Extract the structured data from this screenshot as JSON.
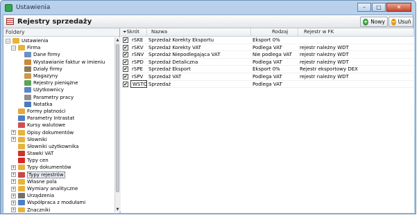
{
  "window": {
    "title": "Ustawienia",
    "buttons": {
      "minimize": "–",
      "maximize": "□",
      "close": "✕"
    }
  },
  "header": {
    "title": "Rejestry sprzedaży",
    "new_label": "Nowy",
    "delete_label": "Usuń"
  },
  "tree": {
    "header": "Foldery",
    "items": [
      {
        "label": "Ustawienia",
        "level": 0,
        "expander": "−",
        "icon": "folder-icon",
        "color": "#e6b33c"
      },
      {
        "label": "Firma",
        "level": 1,
        "expander": "−",
        "icon": "folder-icon",
        "color": "#e6b33c"
      },
      {
        "label": "Dane firmy",
        "level": 2,
        "expander": "",
        "icon": "document-icon",
        "color": "#6c8fc7"
      },
      {
        "label": "Wystawianie faktur w imieniu",
        "level": 2,
        "expander": "",
        "icon": "users-icon",
        "color": "#c98a3d"
      },
      {
        "label": "Działy firmy",
        "level": 2,
        "expander": "",
        "icon": "building-icon",
        "color": "#8d7b5d"
      },
      {
        "label": "Magazyny",
        "level": 2,
        "expander": "",
        "icon": "warehouse-icon",
        "color": "#c99a4f"
      },
      {
        "label": "Rejestry pieniężne",
        "level": 2,
        "expander": "",
        "icon": "money-icon",
        "color": "#5ba35b"
      },
      {
        "label": "Użytkownicy",
        "level": 2,
        "expander": "",
        "icon": "users-icon",
        "color": "#5b86c9"
      },
      {
        "label": "Parametry pracy",
        "level": 2,
        "expander": "",
        "icon": "parameters-icon",
        "color": "#8e8e8e"
      },
      {
        "label": "Notatka",
        "level": 2,
        "expander": "",
        "icon": "note-icon",
        "color": "#4b7bc0"
      },
      {
        "label": "Formy płatności",
        "level": 1,
        "expander": "",
        "icon": "payment-icon",
        "color": "#e5a93a"
      },
      {
        "label": "Parametry Intrastat",
        "level": 1,
        "expander": "",
        "icon": "checkmark-icon",
        "color": "#4f7ec3"
      },
      {
        "label": "Kursy walutowe",
        "level": 1,
        "expander": "",
        "icon": "chart-icon",
        "color": "#d44d4d"
      },
      {
        "label": "Opisy dokumentów",
        "level": 1,
        "expander": "+",
        "icon": "folder-icon",
        "color": "#e6b33c"
      },
      {
        "label": "Słowniki",
        "level": 1,
        "expander": "+",
        "icon": "folder-icon",
        "color": "#e6b33c"
      },
      {
        "label": "Słowniki użytkownika",
        "level": 1,
        "expander": "",
        "icon": "folder-icon",
        "color": "#e6b33c"
      },
      {
        "label": "Stawki VAT",
        "level": 1,
        "expander": "",
        "icon": "vat-icon",
        "color": "#c9352b"
      },
      {
        "label": "Typy cen",
        "level": 1,
        "expander": "",
        "icon": "price-icon",
        "color": "#d82626"
      },
      {
        "label": "Typy dokumentów",
        "level": 1,
        "expander": "+",
        "icon": "folder-icon",
        "color": "#e6b33c"
      },
      {
        "label": "Typy rejestrów",
        "level": 1,
        "expander": "+",
        "icon": "register-icon",
        "color": "#c74848"
      },
      {
        "label": "Własne pola",
        "level": 1,
        "expander": "+",
        "icon": "folder-icon",
        "color": "#e6b33c"
      },
      {
        "label": "Wymiary analityczne",
        "level": 1,
        "expander": "+",
        "icon": "folder-icon",
        "color": "#e6b33c"
      },
      {
        "label": "Urządzenia",
        "level": 1,
        "expander": "+",
        "icon": "printer-icon",
        "color": "#707070"
      },
      {
        "label": "Współpraca z modułami",
        "level": 1,
        "expander": "+",
        "icon": "modules-icon",
        "color": "#4f7ec3"
      },
      {
        "label": "Znaczniki",
        "level": 1,
        "expander": "+",
        "icon": "folder-icon",
        "color": "#e6b33c"
      }
    ],
    "selected_index": 19
  },
  "grid": {
    "columns": {
      "code": "Skrót",
      "name": "Nazwa",
      "type": "Rodzaj",
      "fk": "Rejestr w FK"
    },
    "rows": [
      {
        "checked": "✔",
        "code": "rSKE",
        "name": "Sprzedaż Korekty Eksportu",
        "type": "Eksport 0%",
        "fk": ""
      },
      {
        "checked": "✔",
        "code": "rSKV",
        "name": "Sprzedaż Korekty VAT",
        "type": "Podlega VAT",
        "fk": "rejestr należny WDT"
      },
      {
        "checked": "✔",
        "code": "rSNV",
        "name": "Sprzedaż Niepodlegająca VAT",
        "type": "Nie podlega VAT",
        "fk": "rejestr należny WDT"
      },
      {
        "checked": "✔",
        "code": "rSPD",
        "name": "Sprzedaż Detaliczna",
        "type": "Podlega VAT",
        "fk": "rejestr należny WDT"
      },
      {
        "checked": "✔",
        "code": "rSPE",
        "name": "Sprzedaż Eksport",
        "type": "Eksport 0%",
        "fk": "Rejestr eksportowy DEX"
      },
      {
        "checked": "✔",
        "code": "rSPV",
        "name": "Sprzedaż VAT",
        "type": "Podlega VAT",
        "fk": "rejestr należny WDT"
      },
      {
        "checked": "✔",
        "code": "WSTO",
        "name": "Sprzedaż",
        "type": "Podlega VAT",
        "fk": ""
      }
    ],
    "selected_index": 6
  }
}
